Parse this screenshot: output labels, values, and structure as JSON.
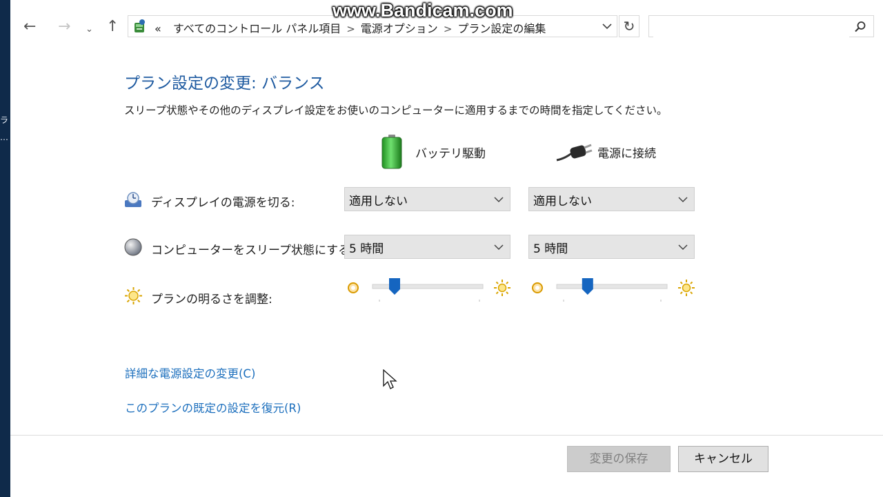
{
  "watermark": "www.Bandicam.com",
  "left_strip": {
    "frag1": "ラ",
    "frag2": "…"
  },
  "nav": {
    "back_icon": "back-arrow-icon",
    "forward_icon": "forward-arrow-icon",
    "recent_icon": "chevron-down-icon",
    "up_icon": "up-arrow-icon"
  },
  "address": {
    "overflow": "«",
    "crumbs": [
      "すべてのコントロール パネル項目",
      "電源オプション",
      "プラン設定の編集"
    ],
    "separator": ">"
  },
  "search": {
    "placeholder": ""
  },
  "main": {
    "title": "プラン設定の変更: バランス",
    "description": "スリープ状態やその他のディスプレイ設定をお使いのコンピューターに適用するまでの時間を指定してください。",
    "columns": {
      "battery": "バッテリ駆動",
      "plugged": "電源に接続"
    },
    "rows": {
      "display_off": {
        "label": "ディスプレイの電源を切る:",
        "battery_value": "適用しない",
        "plugged_value": "適用しない"
      },
      "sleep": {
        "label": "コンピューターをスリープ状態にする:",
        "battery_value": "5 時間",
        "plugged_value": "5 時間"
      },
      "brightness": {
        "label": "プランの明るさを調整:",
        "battery_level": 0.2,
        "plugged_level": 0.28
      }
    },
    "links": {
      "advanced": "詳細な電源設定の変更(C)",
      "restore": "このプランの既定の設定を復元(R)"
    }
  },
  "footer": {
    "save": "変更の保存",
    "cancel": "キャンセル"
  },
  "colors": {
    "title": "#1e5aa0",
    "link": "#1c6fbd",
    "slider_thumb": "#1565c0"
  }
}
